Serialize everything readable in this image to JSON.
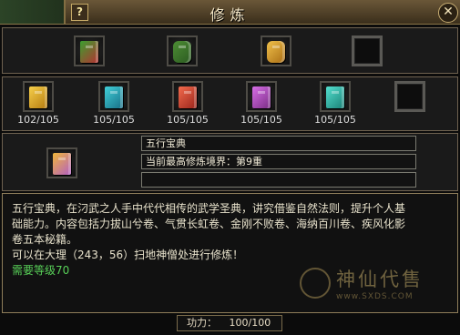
{
  "window": {
    "title": "修炼",
    "help_label": "?",
    "close_label": "✕"
  },
  "top_row": [
    {
      "name": "book-green-red",
      "color": "#3e9d2e"
    },
    {
      "name": "treasure-chest-green",
      "color": "#4b8f35"
    },
    {
      "name": "treasure-chest-gold",
      "color": "#c98f24"
    },
    {
      "name": "empty",
      "color": null
    }
  ],
  "skill_books": [
    {
      "color": "#d8a21e",
      "count": "102/105"
    },
    {
      "color": "#1e9fb5",
      "count": "105/105"
    },
    {
      "color": "#d0402c",
      "count": "105/105"
    },
    {
      "color": "#b04ac0",
      "count": "105/105"
    },
    {
      "color": "#2ab7b0",
      "count": "105/105"
    },
    {
      "color": null,
      "count": ""
    }
  ],
  "selected": {
    "name": "五行宝典",
    "realm_label": "当前最高修炼境界：第9重",
    "extra": ""
  },
  "description": {
    "lines": [
      "五行宝典，在汈武之人手中代代相传的武学圣典，讲究借鉴自然法则，提升个人基",
      "础能力。内容包括力拔山兮卷、气贯长虹卷、金刚不败卷、海纳百川卷、疾风化影",
      "卷五本秘籍。",
      "可以在大理（243，56）扫地神僧处进行修炼！"
    ],
    "requirement": "需要等级70"
  },
  "power": {
    "label": "功力：",
    "value": "100/100"
  },
  "watermark": {
    "main": "神仙代售",
    "url": "www.SXDS.COM"
  }
}
